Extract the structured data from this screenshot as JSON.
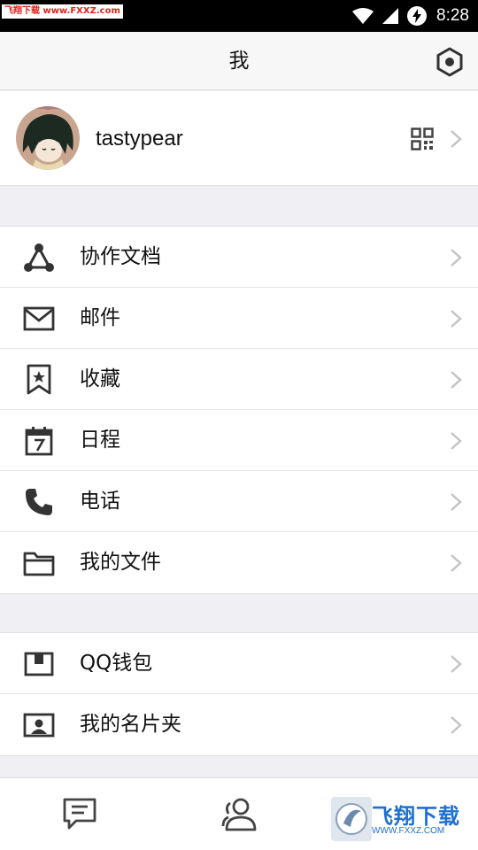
{
  "status_bar": {
    "watermark": "飞翔下载 www.FXXZ.com",
    "time": "8:28",
    "icons": [
      "wifi-icon",
      "cell-signal-icon",
      "battery-charging-icon"
    ]
  },
  "header": {
    "title": "我",
    "settings_icon": "settings-hexagon-icon"
  },
  "profile": {
    "username": "tastypear",
    "qr_icon": "qr-code-icon"
  },
  "groups": [
    {
      "items": [
        {
          "label": "协作文档",
          "icon": "collab-docs-icon"
        },
        {
          "label": "邮件",
          "icon": "mail-icon"
        },
        {
          "label": "收藏",
          "icon": "bookmark-star-icon"
        },
        {
          "label": "日程",
          "icon": "calendar-icon"
        },
        {
          "label": "电话",
          "icon": "phone-icon"
        },
        {
          "label": "我的文件",
          "icon": "folder-icon"
        }
      ]
    },
    {
      "items": [
        {
          "label": "QQ钱包",
          "icon": "wallet-icon"
        },
        {
          "label": "我的名片夹",
          "icon": "card-holder-icon"
        }
      ]
    }
  ],
  "tab_bar": {
    "tabs": [
      {
        "icon": "message-icon"
      },
      {
        "icon": "contacts-icon"
      }
    ],
    "watermark": {
      "title": "飞翔下载",
      "url": "WWW.FXXZ.COM"
    }
  },
  "colors": {
    "background": "#efeff4",
    "title_bar": "#f7f7f7",
    "icon": "#333333",
    "chevron": "#c4c4c4",
    "watermark_blue": "#1f6fd1"
  }
}
